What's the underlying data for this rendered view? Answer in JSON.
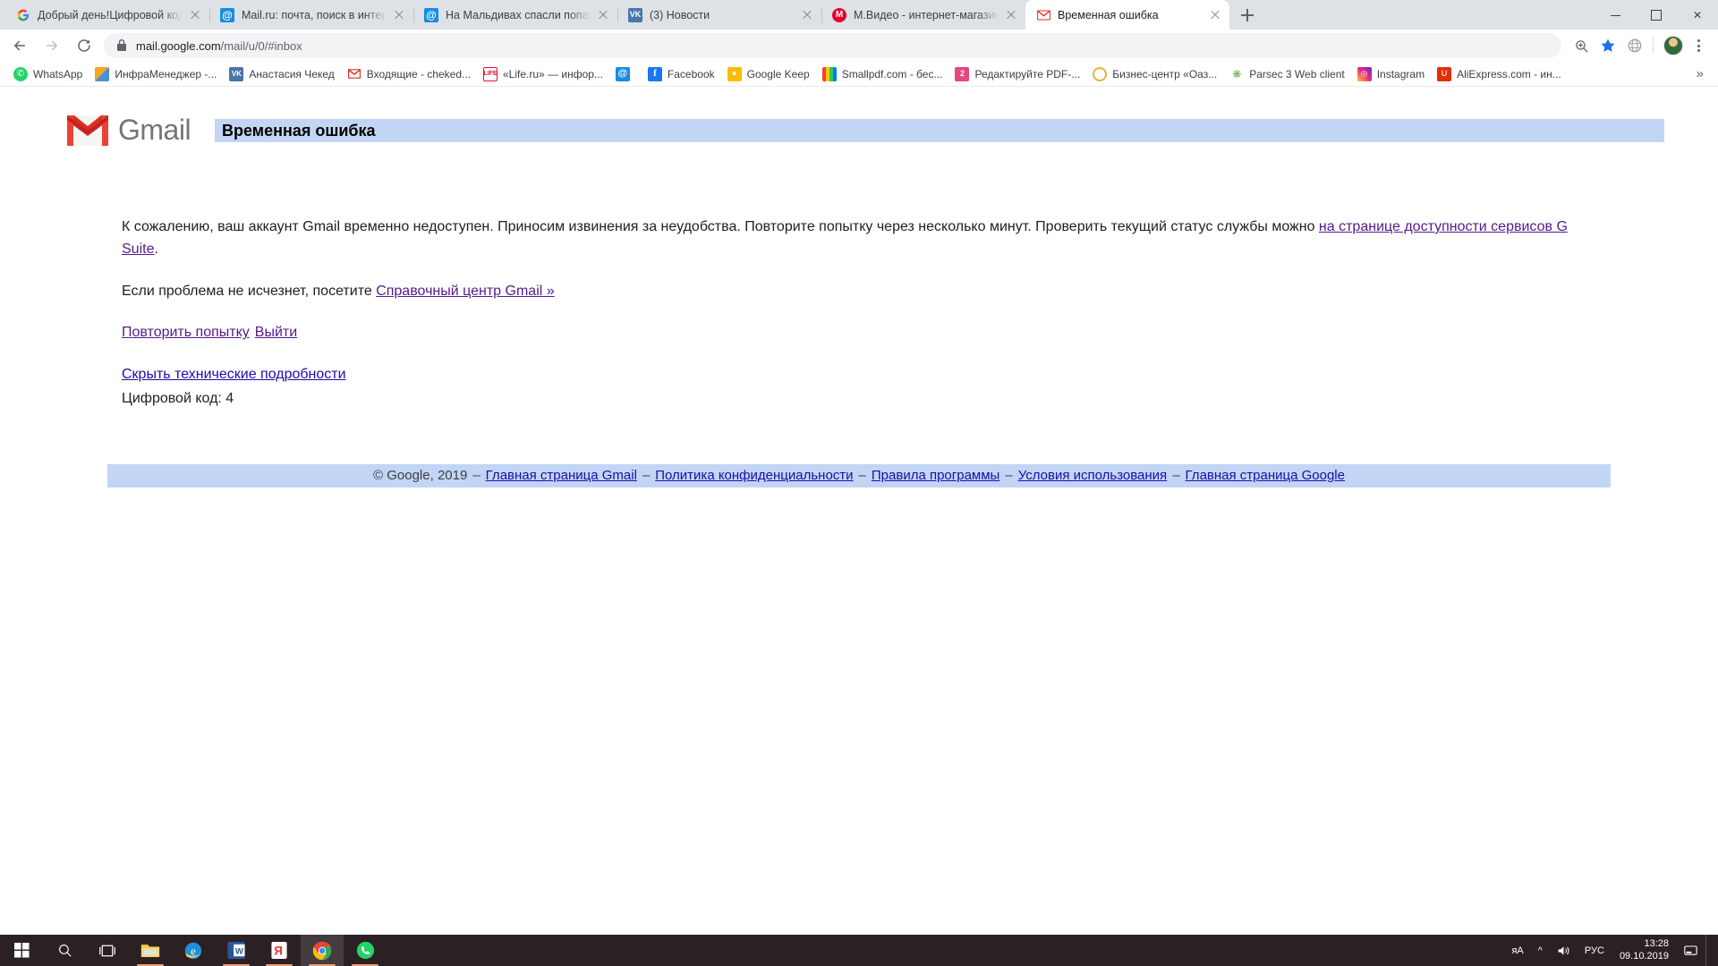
{
  "window": {
    "controls": {
      "minimize": "minimize-icon",
      "maximize": "maximize-icon",
      "close": "close-icon"
    }
  },
  "tabs": [
    {
      "title": "Добрый день!Цифровой код о",
      "favicon": "google-icon",
      "active": false
    },
    {
      "title": "Mail.ru: почта, поиск в интернет",
      "favicon": "mailru-icon",
      "active": false
    },
    {
      "title": "На Мальдивах спасли попавшу",
      "favicon": "mailru-icon",
      "active": false
    },
    {
      "title": "(3) Новости",
      "favicon": "vk-icon",
      "active": false
    },
    {
      "title": "М.Видео - интернет-магазин ци",
      "favicon": "mvideo-icon",
      "active": false
    },
    {
      "title": "Временная ошибка",
      "favicon": "gmail-icon",
      "active": true
    }
  ],
  "newtab_label": "+",
  "toolbar": {
    "back": "back-arrow-icon",
    "forward": "forward-arrow-icon",
    "reload": "reload-icon",
    "lock": "lock-icon",
    "url_secure": "mail.google.com",
    "url_path": "/mail/u/0/#inbox",
    "url_full": "mail.google.com/mail/u/0/#inbox",
    "zoom_icon": "zoom-in-icon",
    "bookmark_star": "star-icon",
    "extensions": "globe-icon",
    "profile": "avatar",
    "menu": "kebab-menu-icon"
  },
  "bookmarks": [
    {
      "label": "WhatsApp",
      "icon": "whatsapp-icon"
    },
    {
      "label": "ИнфраМенеджер -...",
      "icon": "inframanager-icon"
    },
    {
      "label": "Анастасия Чекед",
      "icon": "vk-icon"
    },
    {
      "label": "Входящие - cheked...",
      "icon": "gmail-icon"
    },
    {
      "label": "«Life.ru» — инфор...",
      "icon": "life-icon"
    },
    {
      "label": "",
      "icon": "mailru-icon"
    },
    {
      "label": "Facebook",
      "icon": "facebook-icon"
    },
    {
      "label": "Google Keep",
      "icon": "keep-icon"
    },
    {
      "label": "Smallpdf.com - бес...",
      "icon": "smallpdf-icon"
    },
    {
      "label": "Редактируйте PDF-...",
      "icon": "pdf2-icon"
    },
    {
      "label": "Бизнес-центр «Оаз...",
      "icon": "oasis-icon"
    },
    {
      "label": "Parsec 3 Web client",
      "icon": "parsec-icon"
    },
    {
      "label": "Instagram",
      "icon": "instagram-icon"
    },
    {
      "label": "AliExpress.com - ин...",
      "icon": "aliexpress-icon"
    }
  ],
  "bookmarks_overflow": "»",
  "gmail": {
    "logo_text": "Gmail",
    "page_title": "Временная ошибка",
    "paragraph1_before": "К сожалению, ваш аккаунт Gmail временно недоступен. Приносим извинения за неудобства. Повторите попытку через несколько минут. Проверить текущий статус службы можно ",
    "paragraph1_link": "на странице доступности сервисов G Suite",
    "paragraph1_after": ".",
    "paragraph2_before": "Если проблема не исчезнет, посетите ",
    "paragraph2_link": "Справочный центр Gmail »",
    "action_retry": "Повторить попытку",
    "action_signout": "Выйти",
    "tech_toggle": "Скрыть технические подробности",
    "tech_code": "Цифровой код: 4",
    "footer": {
      "copyright": "© Google, 2019",
      "separator": "–",
      "links": [
        "Главная страница Gmail",
        "Политика конфиденциальности",
        "Правила программы",
        "Условия использования",
        "Главная страница Google"
      ]
    }
  },
  "taskbar": {
    "start": "windows-start-icon",
    "search": "search-icon",
    "taskview": "task-view-icon",
    "apps": [
      {
        "name": "file-explorer-icon",
        "running": true
      },
      {
        "name": "internet-explorer-icon",
        "running": false
      },
      {
        "name": "word-icon",
        "running": true
      },
      {
        "name": "yandex-browser-icon",
        "running": true
      },
      {
        "name": "chrome-icon",
        "running": true,
        "active": true
      },
      {
        "name": "whatsapp-icon",
        "running": true
      }
    ],
    "tray": {
      "input_indicator": "яA",
      "chevron": "^",
      "volume": "volume-icon",
      "language": "РУС",
      "time": "13:28",
      "date": "09.10.2019",
      "notifications": "notification-icon"
    }
  },
  "colors": {
    "chrome_tabstrip": "#dee1e6",
    "gmail_red": "#d93025",
    "band_blue": "#c3d5f5",
    "link_visited": "#551a8b",
    "link_fresh": "#1a0dab",
    "taskbar": "#2b2125"
  }
}
